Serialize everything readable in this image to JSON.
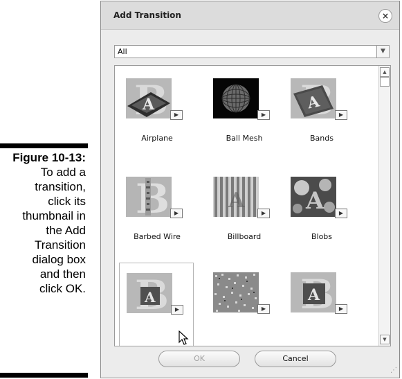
{
  "caption": {
    "figure": "Figure 10-13:",
    "lines": [
      "To add a",
      "transition,",
      "click its",
      "thumbnail in",
      "the Add",
      "Transition",
      "dialog box",
      "and then",
      "click OK."
    ]
  },
  "dialog": {
    "title": "Add Transition",
    "close_glyph": "×",
    "filter": {
      "selected": "All",
      "arrow_glyph": "▼"
    },
    "scroll": {
      "up_glyph": "▲",
      "down_glyph": "▼"
    },
    "play_glyph": "▶",
    "items": [
      {
        "label": "Airplane"
      },
      {
        "label": "Ball Mesh"
      },
      {
        "label": "Bands"
      },
      {
        "label": "Barbed Wire"
      },
      {
        "label": "Billboard"
      },
      {
        "label": "Blobs"
      },
      {
        "label": ""
      },
      {
        "label": ""
      },
      {
        "label": ""
      }
    ],
    "ok_label": "OK",
    "cancel_label": "Cancel",
    "grip_glyph": "⋰"
  }
}
